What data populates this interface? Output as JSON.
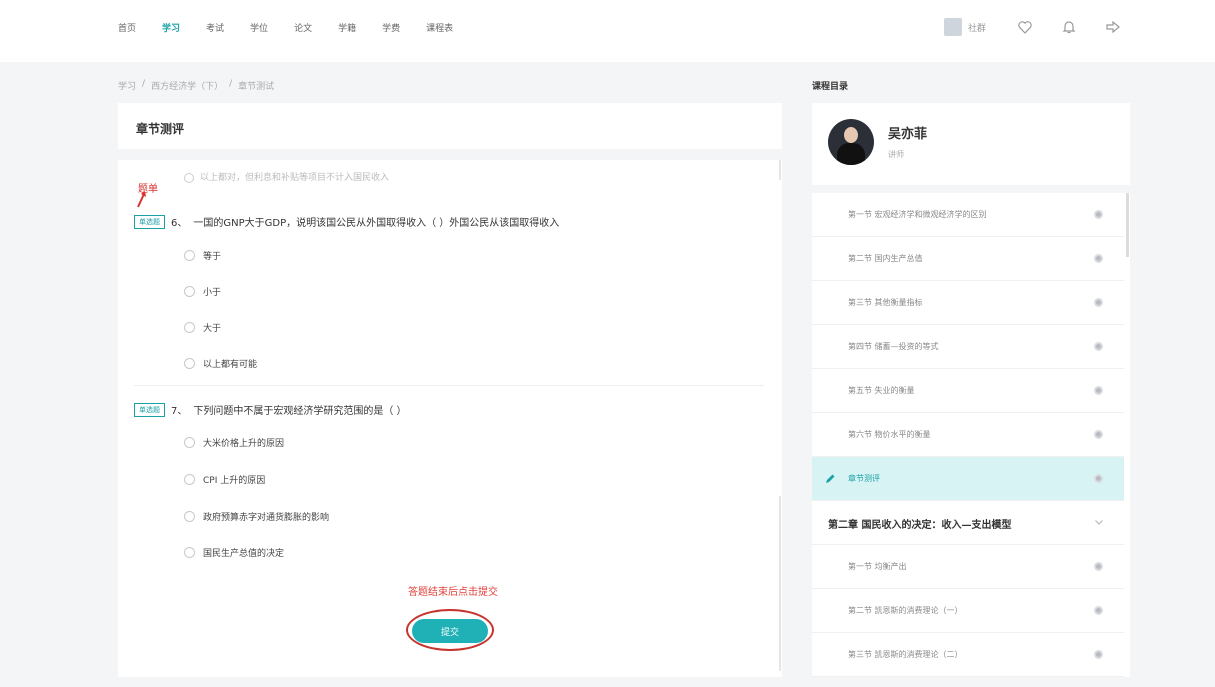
{
  "nav": {
    "items": [
      "首页",
      "学习",
      "考试",
      "学位",
      "论文",
      "学籍",
      "学费",
      "课程表"
    ],
    "active_index": 1,
    "username": "社群",
    "icons": [
      "heart-icon",
      "bell-icon",
      "logout-icon"
    ]
  },
  "breadcrumb": [
    "学习",
    "西方经济学（下）",
    "章节测试"
  ],
  "main": {
    "title": "章节测评",
    "cut_option": "以上都对，但利息和补贴等项目不计入国民收入",
    "annotation_title": "题单",
    "questions": [
      {
        "tag": "单选题",
        "number": "6、",
        "text": "一国的GNP大于GDP，说明该国公民从外国取得收入（  ）外国公民从该国取得收入",
        "options": [
          "等于",
          "小于",
          "大于",
          "以上都有可能"
        ]
      },
      {
        "tag": "单选题",
        "number": "7、",
        "text": "下列问题中不属于宏观经济学研究范围的是（  ）",
        "options": [
          "大米价格上升的原因",
          "CPI 上升的原因",
          "政府预算赤字对通货膨胀的影响",
          "国民生产总值的决定"
        ]
      }
    ],
    "hint": "答题结束后点击提交",
    "submit_label": "提交"
  },
  "sidebar": {
    "title": "课程目录",
    "teacher_name": "吴亦菲",
    "teacher_role": "讲师",
    "sections_ch1": [
      "第一节 宏观经济学和微观经济学的区别",
      "第二节 国内生产总值",
      "第三节 其他衡量指标",
      "第四节 储蓄—投资的等式",
      "第五节 失业的衡量",
      "第六节 物价水平的衡量",
      "章节测评"
    ],
    "chapter2_title": "第二章 国民收入的决定：收入—支出模型",
    "sections_ch2": [
      "第一节 均衡产出",
      "第二节 凯恩斯的消费理论（一）",
      "第三节 凯恩斯的消费理论（二）"
    ]
  },
  "colors": {
    "accent": "#1aa1a8",
    "submit_button": "#1fb1b5",
    "annotation_red": "#d9312f",
    "active_row_bg": "#d8f3f4"
  }
}
